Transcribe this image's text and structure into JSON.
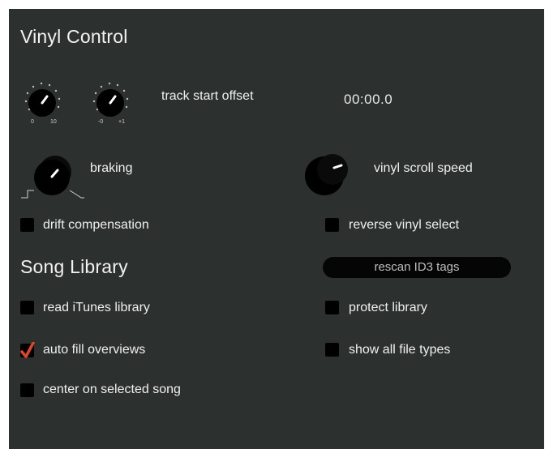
{
  "vinyl_control": {
    "title": "Vinyl Control",
    "knob1": {
      "min_label": "0",
      "max_label": "10"
    },
    "knob2": {
      "min_label": "-0",
      "max_label": "+1"
    },
    "track_start_offset_label": "track start offset",
    "track_start_offset_value": "00:00.0",
    "braking_label": "braking",
    "vinyl_scroll_speed_label": "vinyl scroll speed",
    "drift_compensation": {
      "label": "drift compensation",
      "checked": false
    },
    "reverse_vinyl_select": {
      "label": "reverse vinyl select",
      "checked": false
    }
  },
  "song_library": {
    "title": "Song Library",
    "rescan_button": "rescan ID3 tags",
    "read_itunes": {
      "label": "read iTunes library",
      "checked": false
    },
    "protect_library": {
      "label": "protect library",
      "checked": false
    },
    "auto_fill_overviews": {
      "label": "auto fill overviews",
      "checked": true
    },
    "show_all_file_types": {
      "label": "show all file types",
      "checked": false
    },
    "center_on_selected": {
      "label": "center on selected song",
      "checked": false
    }
  },
  "colors": {
    "panel": "#2c3130",
    "checkmark": "#e0452a",
    "checkbox": "#000000"
  },
  "icons": [
    "knob-icon",
    "checkmark-icon",
    "brake-curve-icon"
  ]
}
